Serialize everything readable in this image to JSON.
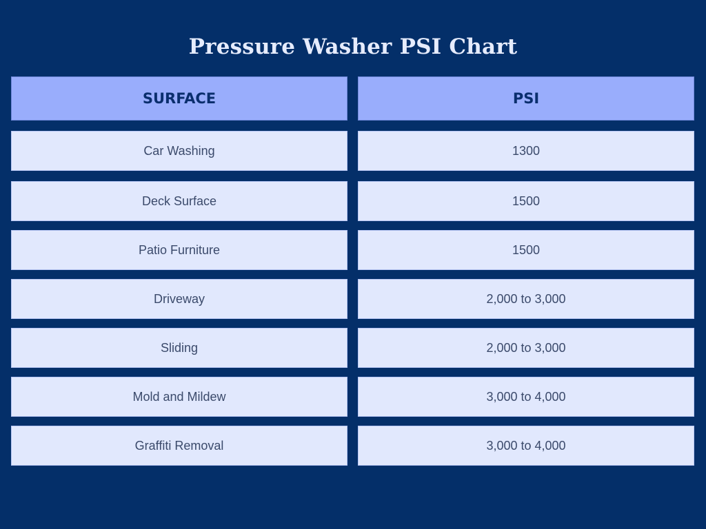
{
  "title": "Pressure Washer PSI Chart",
  "colors": {
    "background": "#042f69",
    "header_fill": "#99adfc",
    "row_fill": "#e1e8fd",
    "header_text": "#0a2e6d",
    "title_text": "#e6ecfd"
  },
  "chart_data": {
    "type": "table",
    "title": "Pressure Washer PSI Chart",
    "columns": [
      "SURFACE",
      "PSI"
    ],
    "rows": [
      [
        "Car Washing",
        "1300"
      ],
      [
        "Deck Surface",
        "1500"
      ],
      [
        "Patio Furniture",
        "1500"
      ],
      [
        "Driveway",
        "2,000 to 3,000"
      ],
      [
        "Sliding",
        "2,000 to 3,000"
      ],
      [
        "Mold and Mildew",
        "3,000 to 4,000"
      ],
      [
        "Graffiti Removal",
        "3,000 to 4,000"
      ]
    ]
  }
}
